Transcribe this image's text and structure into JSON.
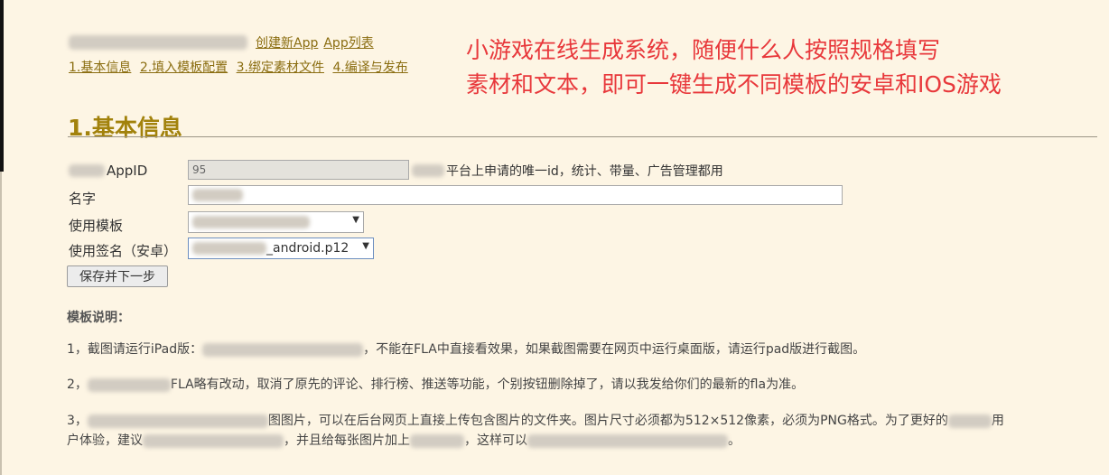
{
  "topnav": {
    "create_app": "创建新App",
    "app_list": "App列表",
    "steps": [
      "1.基本信息",
      "2.填入模板配置",
      "3.绑定素材文件",
      "4.编译与发布"
    ]
  },
  "annotation": {
    "line1": "小游戏在线生成系统，随便什么人按照规格填写",
    "line2": "素材和文本，即可一键生成不同模板的安卓和IOS游戏"
  },
  "section": {
    "title": "1.基本信息"
  },
  "form": {
    "appid_label": "AppID",
    "appid_value": "95",
    "appid_hint": "平台上申请的唯一id，统计、带量、广告管理都用",
    "name_label": "名字",
    "template_label": "使用模板",
    "signature_label": "使用签名（安卓）",
    "signature_value": "_android.p12",
    "save_button": "保存并下一步"
  },
  "notes": {
    "title": "模板说明：",
    "note1_a": "1，截图请运行iPad版：",
    "note1_b": "，不能在FLA中直接看效果，如果截图需要在网页中运行桌面版，请运行pad版进行截图。",
    "note2_a": "2，",
    "note2_b": "FLA略有改动，取消了原先的评论、排行榜、推送等功能，个别按钮删除掉了，请以我发给你们的最新的fla为准。",
    "note3_a": "3，",
    "note3_b": "图图片，可以在后台网页上直接上传包含图片的文件夹。图片尺寸必须都为512×512像素，必须为PNG格式。为了更好的",
    "note3_c": "用",
    "note3_d": "户体验，建议",
    "note3_e": "，并且给每张图片加上",
    "note3_f": "，这样可以",
    "note3_g": "。"
  }
}
